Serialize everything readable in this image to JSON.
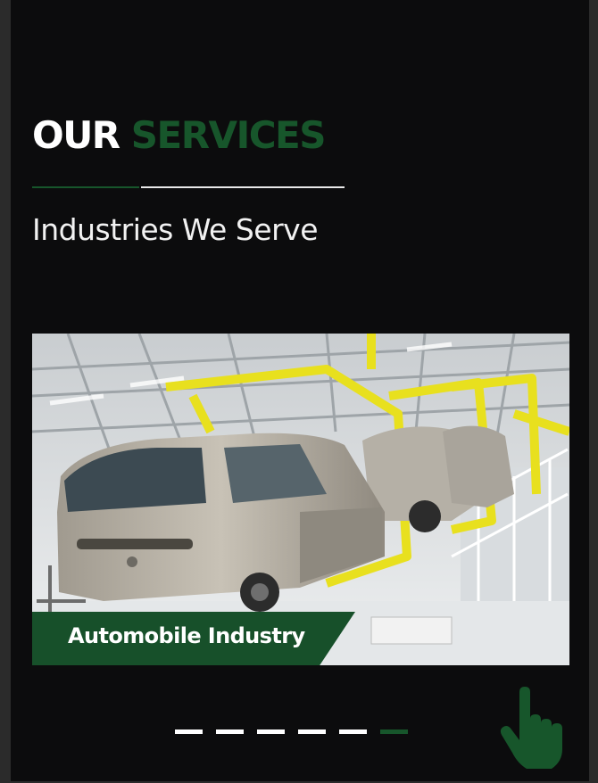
{
  "section": {
    "heading_word1": "OUR",
    "heading_word2": "SERVICES",
    "subtitle": "Industries We Serve"
  },
  "slider": {
    "current_caption": "Automobile Industry",
    "slide_count": 6,
    "active_index": 5,
    "image_description_icon": "car-assembly-line-photo"
  },
  "colors": {
    "background": "#0c0c0d",
    "brand_green": "#17562b",
    "caption_green": "#17502a",
    "text_white": "#ffffff"
  },
  "icons": {
    "pointer": "hand-pointer-icon"
  }
}
